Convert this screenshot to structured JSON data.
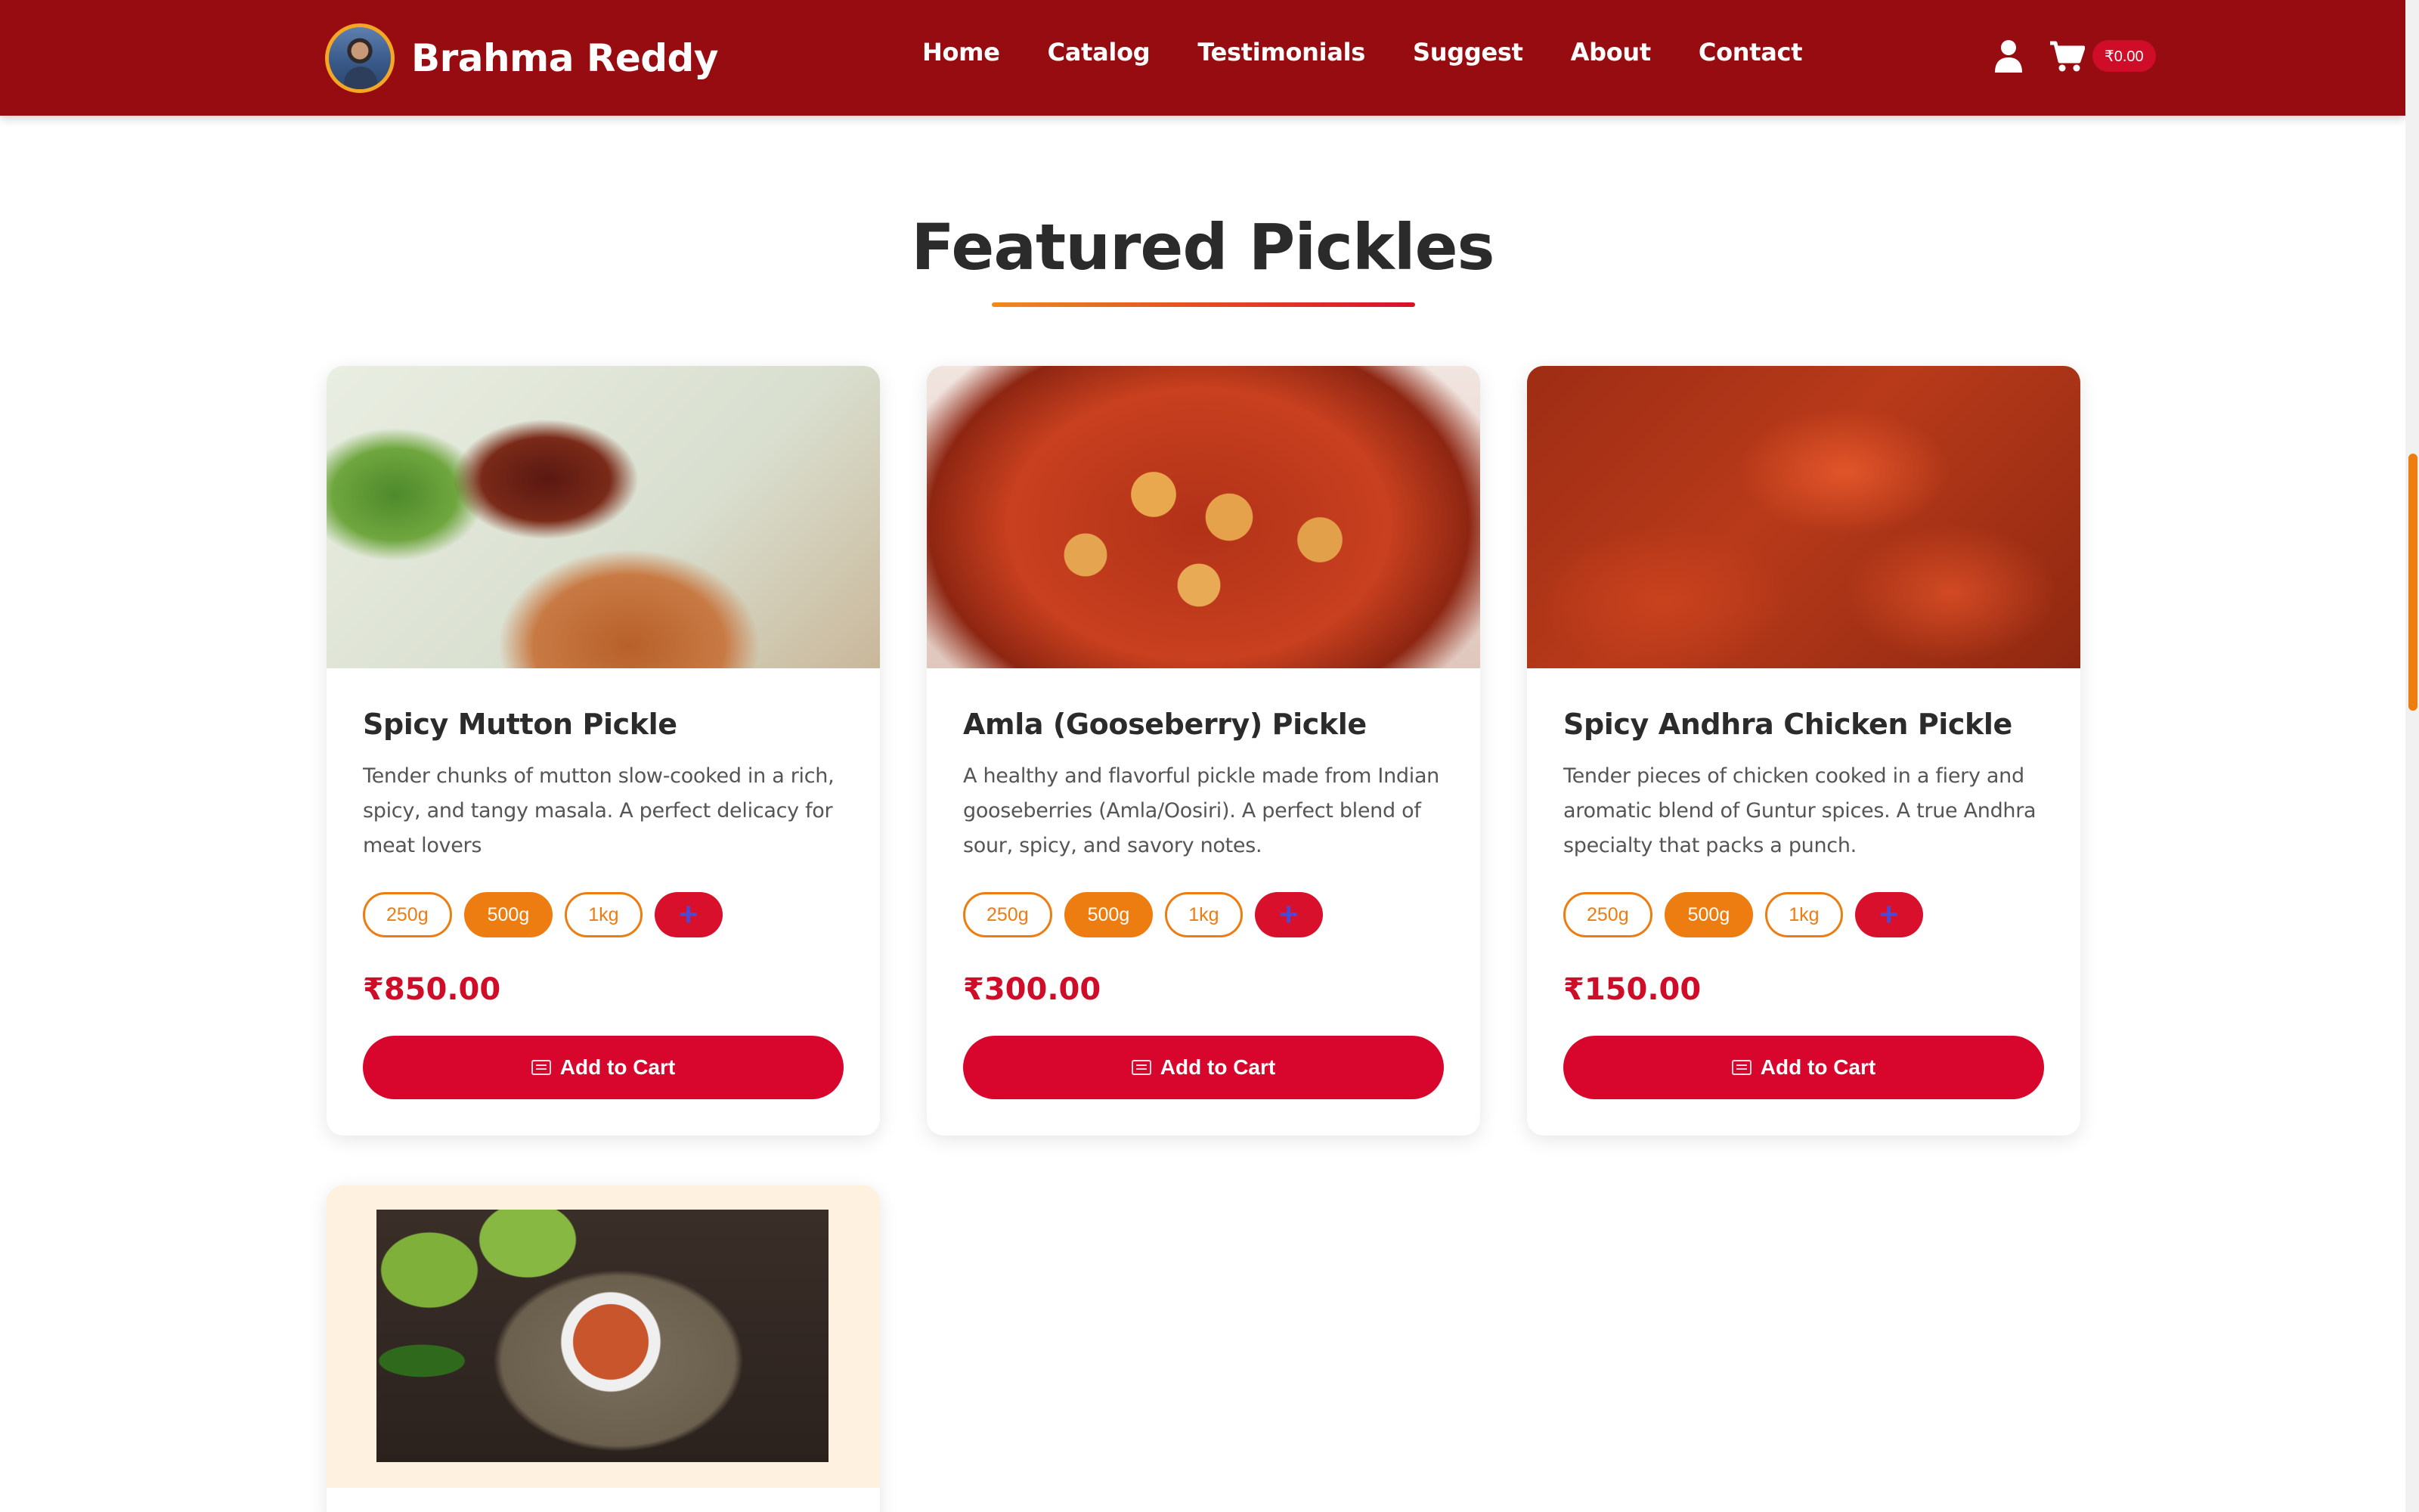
{
  "header": {
    "brand_name": "Brahma Reddy",
    "nav": [
      "Home",
      "Catalog",
      "Testimonials",
      "Suggest",
      "About",
      "Contact"
    ],
    "cart_total": "₹0.00",
    "icons": [
      "user-icon",
      "cart-icon"
    ]
  },
  "section": {
    "title": "Featured Pickles"
  },
  "products": [
    {
      "name": "Spicy Mutton Pickle",
      "description": "Tender chunks of mutton slow-cooked in a rich, spicy, and tangy masala. A perfect delicacy for meat lovers",
      "sizes": [
        "250g",
        "500g",
        "1kg"
      ],
      "selected_size": "500g",
      "add_size_label": "+",
      "price": "₹850.00",
      "cart_label": "Add to Cart"
    },
    {
      "name": "Amla (Gooseberry) Pickle",
      "description": "A healthy and flavorful pickle made from Indian gooseberries (Amla/Oosiri). A perfect blend of sour, spicy, and savory notes.",
      "sizes": [
        "250g",
        "500g",
        "1kg"
      ],
      "selected_size": "500g",
      "add_size_label": "+",
      "price": "₹300.00",
      "cart_label": "Add to Cart"
    },
    {
      "name": "Spicy Andhra Chicken Pickle",
      "description": "Tender pieces of chicken cooked in a fiery and aromatic blend of Guntur spices. A true Andhra specialty that packs a punch.",
      "sizes": [
        "250g",
        "500g",
        "1kg"
      ],
      "selected_size": "500g",
      "add_size_label": "+",
      "price": "₹150.00",
      "cart_label": "Add to Cart"
    }
  ],
  "colors": {
    "header_bg": "#970c10",
    "accent_orange": "#ee7d11",
    "accent_red": "#d8062c"
  }
}
